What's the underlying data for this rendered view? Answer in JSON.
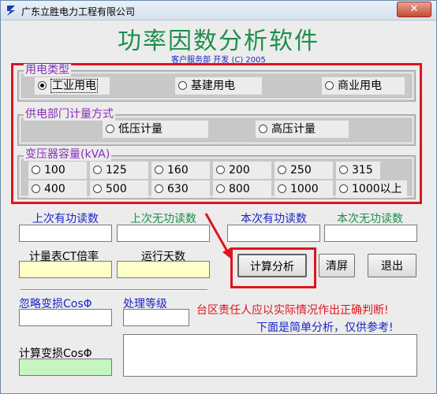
{
  "window": {
    "title": "广东立胜电力工程有限公司",
    "close_label": "✕"
  },
  "header": {
    "app_title": "功率因数分析软件",
    "subtitle": "客户服务部 开发 (C) 2005"
  },
  "power_type": {
    "label": "用电类型",
    "options": [
      "工业用电",
      "基建用电",
      "商业用电"
    ],
    "selected": "工业用电"
  },
  "metering": {
    "label": "供电部门计量方式",
    "options": [
      "低压计量",
      "高压计量"
    ]
  },
  "transformer": {
    "label": "变压器容量(kVA)",
    "options": [
      "100",
      "125",
      "160",
      "200",
      "250",
      "315",
      "400",
      "500",
      "630",
      "800",
      "1000",
      "1000以上"
    ]
  },
  "readings": {
    "last_active": "上次有功读数",
    "last_reactive": "上次无功读数",
    "current_active": "本次有功读数",
    "current_reactive": "本次无功读数",
    "ct_ratio": "计量表CT倍率",
    "run_days": "运行天数",
    "ignore_cos": "忽略变损CosΦ",
    "grade": "处理等级",
    "calc_cos": "计算变损CosΦ"
  },
  "buttons": {
    "analyze": "计算分析",
    "clear": "清屏",
    "exit": "退出"
  },
  "messages": {
    "warning": "台区责任人应以实际情况作出正确判断!",
    "note": "下面是简单分析，仅供参考!"
  },
  "colors": {
    "title_green": "#1d8f4a",
    "label_purple": "#8a2fb8",
    "highlight_red": "#e0141e",
    "info_blue": "#1a24c8"
  }
}
